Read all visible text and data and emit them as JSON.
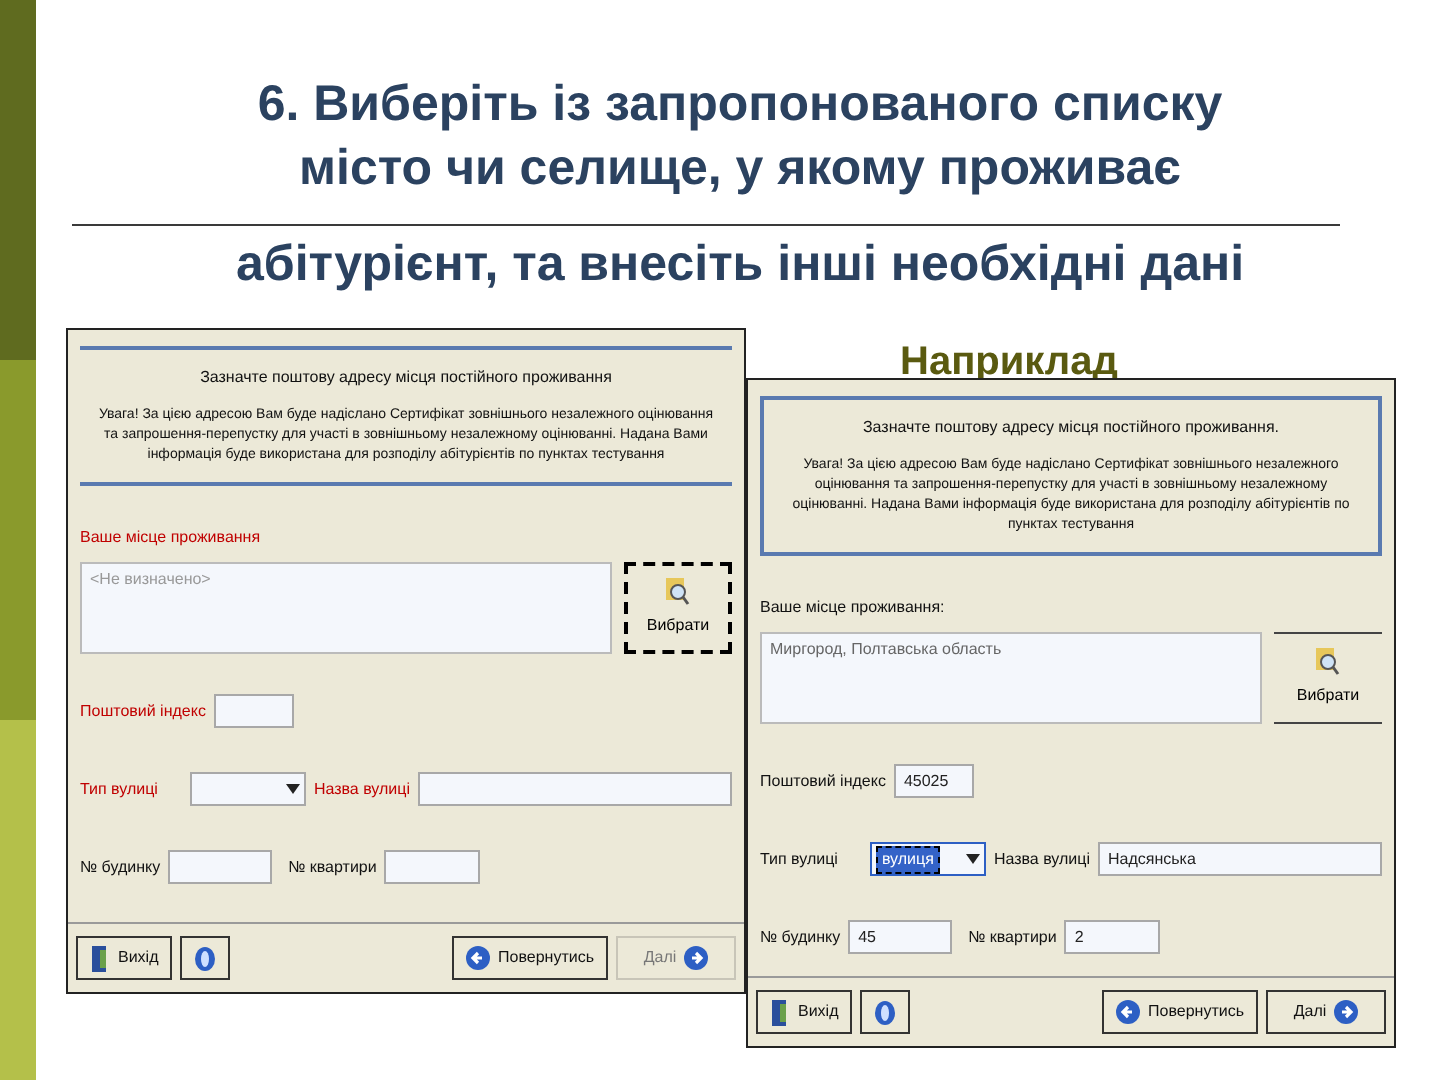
{
  "slide": {
    "title_lines": [
      "6. Виберіть із запропонованого списку",
      "місто чи селище, у якому проживає",
      "абітурієнт, та внесіть інші необхідні дані"
    ],
    "example_label": "Наприклад"
  },
  "forms": [
    {
      "heading": "Зазначте поштову адресу місця постійного проживання",
      "notice": "Увага! За цією адресою Вам буде надіслано Сертифікат зовнішнього незалежного оцінювання та запрошення-перепустку для участі в зовнішньому незалежному оцінюванні. Надана Вами інформація буде використана для розподілу абітурієнтів по пунктах тестування",
      "residence": {
        "label": "Ваше місце проживання",
        "required_missing": true,
        "placeholder": "<Не визначено>",
        "button": "Вибрати"
      },
      "fields": [
        {
          "kind": "text",
          "label": "Поштовий індекс",
          "required_missing": true
        },
        {
          "kind": "pair",
          "label": "Тип вулиці",
          "required_missing": true,
          "focused": false,
          "label2": "Назва вулиці",
          "required_missing2": true
        },
        {
          "kind": "pair2",
          "label": "№ будинку",
          "required_missing": false,
          "label2": "№ квартири",
          "required_missing2": false
        }
      ],
      "buttons": [
        {
          "kind": "exit",
          "label": "Вихід",
          "disabled": false
        },
        {
          "kind": "help",
          "disabled": false
        },
        {
          "kind": "back",
          "label": "Повернутись",
          "disabled": false
        },
        {
          "kind": "next",
          "label": "Далі",
          "disabled": true
        }
      ]
    },
    {
      "heading": "Зазначте поштову адресу місця постійного проживання.",
      "notice": "Увага! За цією адресою Вам буде надіслано Сертифікат зовнішнього незалежного оцінювання та запрошення-перепустку для участі в зовнішньому незалежному оцінюванні. Надана Вами інформація буде використана для розподілу абітурієнтів по пунктах тестування",
      "residence": {
        "label": "Ваше місце проживання:",
        "required_missing": false,
        "value": "Миргород, Полтавська область",
        "button": "Вибрати"
      },
      "fields": [
        {
          "kind": "text",
          "label": "Поштовий індекс",
          "required_missing": false,
          "value": "45025"
        },
        {
          "kind": "pair",
          "label": "Тип вулиці",
          "required_missing": false,
          "focused": true,
          "value": "вулиця",
          "label2": "Назва вулиці",
          "required_missing2": false,
          "value2": "Надсянська"
        },
        {
          "kind": "pair2",
          "label": "№ будинку",
          "required_missing": false,
          "value": "45",
          "label2": "№ квартири",
          "required_missing2": false,
          "value2": "2"
        }
      ],
      "buttons": [
        {
          "kind": "exit",
          "label": "Вихід",
          "disabled": false
        },
        {
          "kind": "help",
          "disabled": false
        },
        {
          "kind": "back",
          "label": "Повернутись",
          "disabled": false
        },
        {
          "kind": "next",
          "label": "Далі",
          "disabled": false
        }
      ]
    }
  ]
}
